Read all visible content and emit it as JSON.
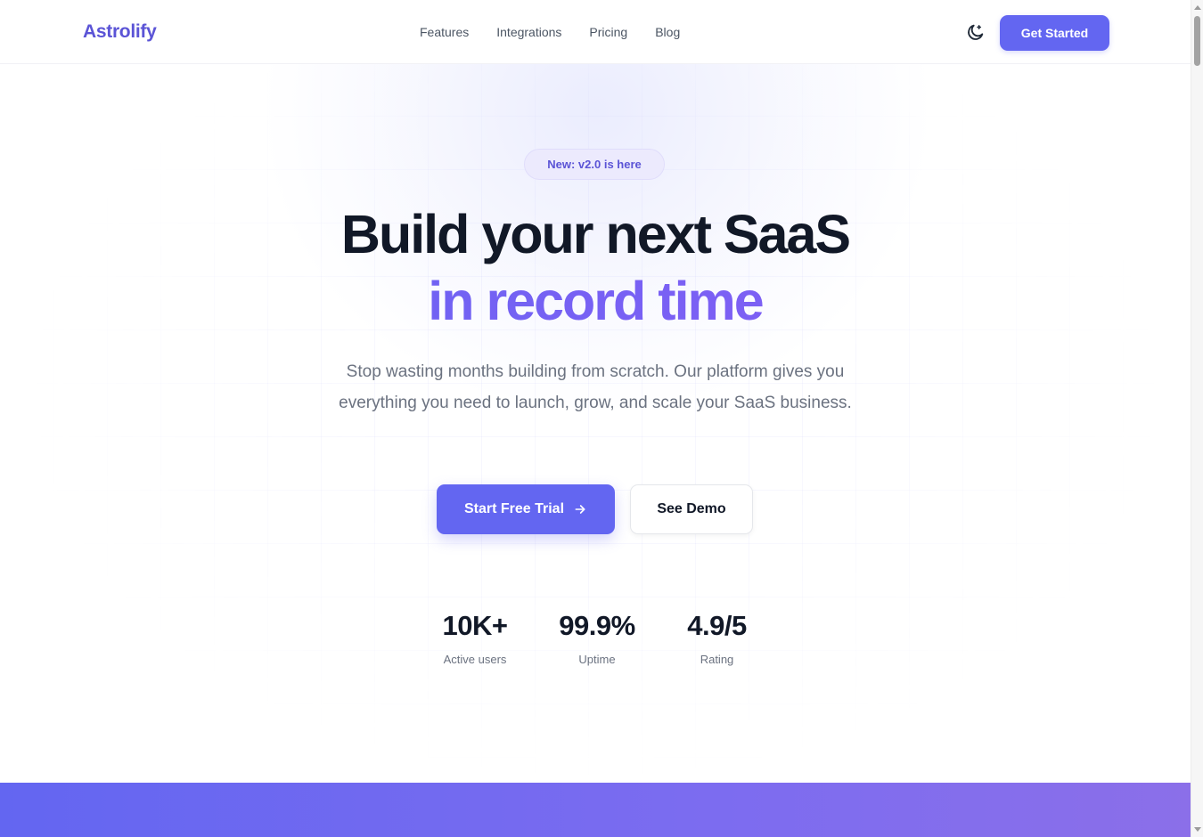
{
  "header": {
    "logo": "Astrolify",
    "nav": [
      "Features",
      "Integrations",
      "Pricing",
      "Blog"
    ],
    "theme_icon": "moon-icon",
    "cta_label": "Get Started"
  },
  "hero": {
    "badge": "New: v2.0 is here",
    "title_line1": "Build your next SaaS",
    "title_line2": "in record time",
    "subtitle": "Stop wasting months building from scratch. Our platform gives you everything you need to launch, grow, and scale your SaaS business.",
    "primary_cta": "Start Free Trial",
    "primary_cta_icon": "arrow-right-icon",
    "secondary_cta": "See Demo"
  },
  "stats": [
    {
      "value": "10K+",
      "label": "Active users"
    },
    {
      "value": "99.9%",
      "label": "Uptime"
    },
    {
      "value": "4.9/5",
      "label": "Rating"
    }
  ],
  "colors": {
    "accent": "#6366f1",
    "accent_gradient_end": "#8b5cf6",
    "heading": "#111827",
    "body_text": "#6b7280"
  }
}
